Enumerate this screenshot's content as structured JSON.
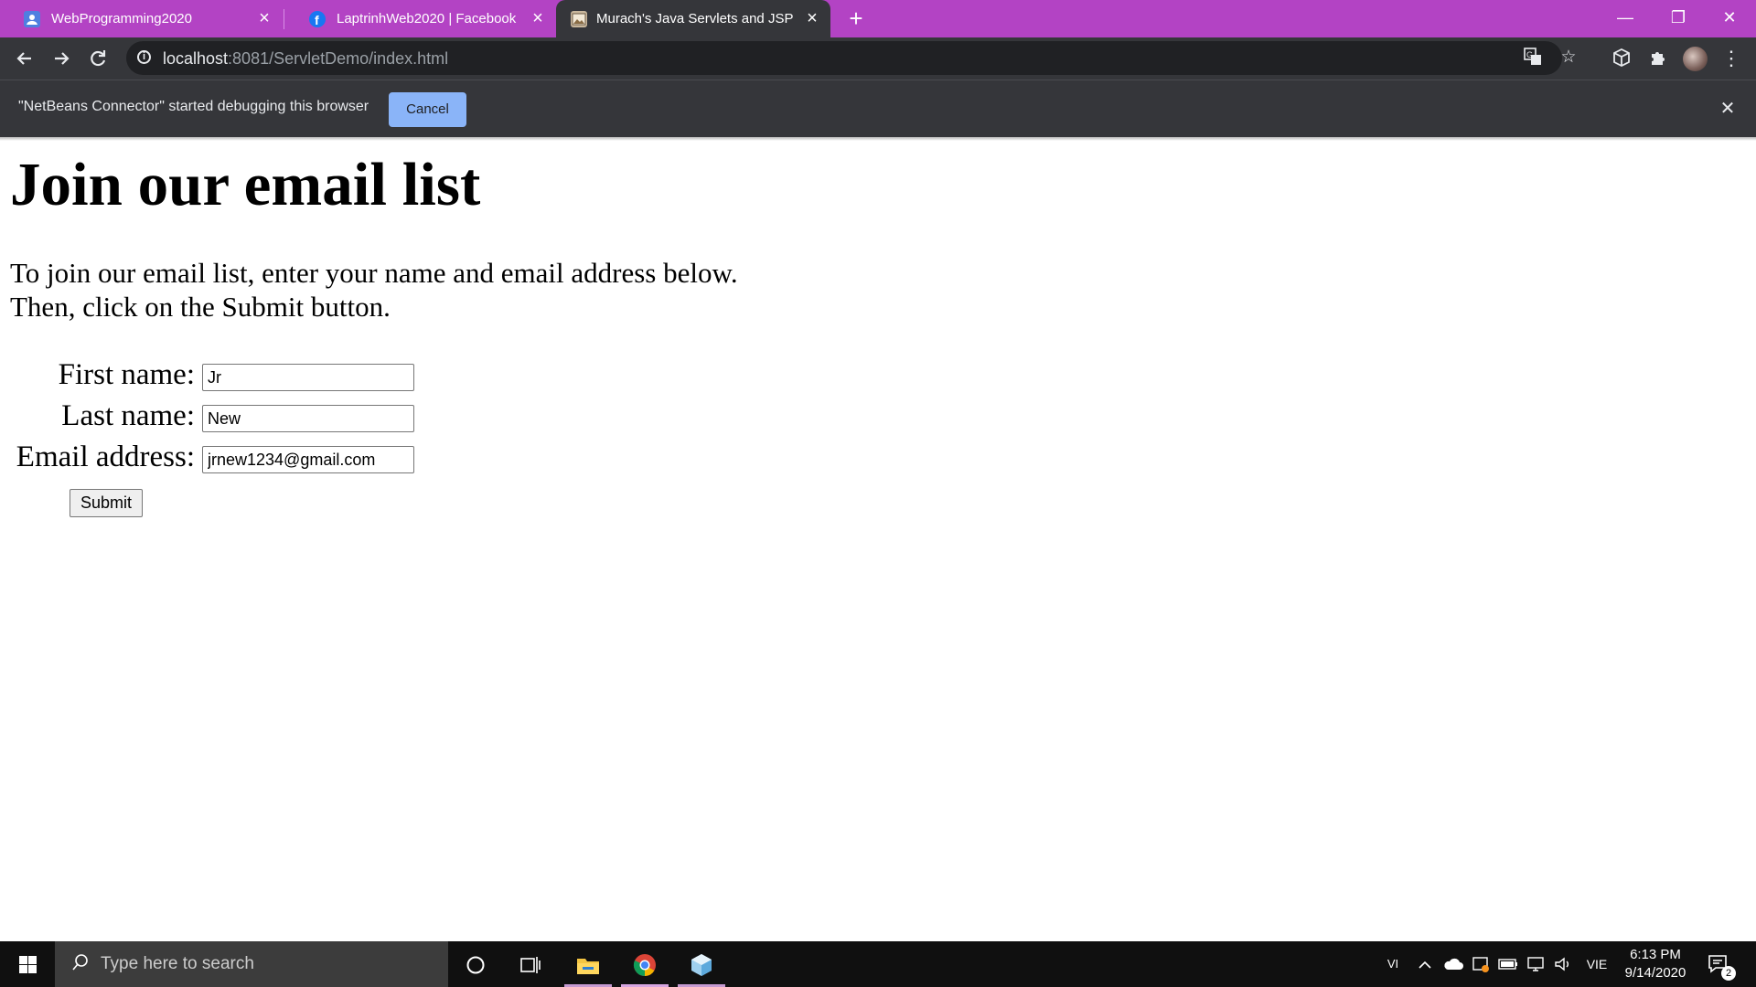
{
  "browser": {
    "tabs": [
      {
        "title": "WebProgramming2020",
        "favicon": "user-icon",
        "active": false
      },
      {
        "title": "LaptrinhWeb2020 | Facebook",
        "favicon": "facebook-icon",
        "active": false
      },
      {
        "title": "Murach's Java Servlets and JSP",
        "favicon": "image-icon",
        "active": true
      }
    ],
    "new_tab": "+",
    "window": {
      "minimize": "—",
      "restore": "❐",
      "close": "✕"
    },
    "address": {
      "host": "localhost",
      "rest": ":8081/ServletDemo/index.html"
    },
    "infobar": {
      "message": "\"NetBeans Connector\" started debugging this browser",
      "cancel_label": "Cancel",
      "close": "✕"
    },
    "colors": {
      "tab_strip": "#b343c4",
      "toolbar": "#35363a",
      "cancel_button": "#8ab4f8"
    }
  },
  "page": {
    "heading": "Join our email list",
    "intro_line1": "To join our email list, enter your name and email address below.",
    "intro_line2": "Then, click on the Submit button.",
    "form": {
      "first_name_label": "First name:",
      "first_name_value": "Jr",
      "last_name_label": "Last name:",
      "last_name_value": "New",
      "email_label": "Email address:",
      "email_value": "jrnew1234@gmail.com",
      "submit_label": "Submit"
    }
  },
  "taskbar": {
    "search_placeholder": "Type here to search",
    "ime": "VI",
    "language": "VIE",
    "time": "6:13 PM",
    "date": "9/14/2020",
    "notification_count": "2",
    "apps": [
      "cortana-icon",
      "task-view-icon",
      "file-explorer-icon",
      "chrome-icon",
      "netbeans-icon"
    ]
  }
}
